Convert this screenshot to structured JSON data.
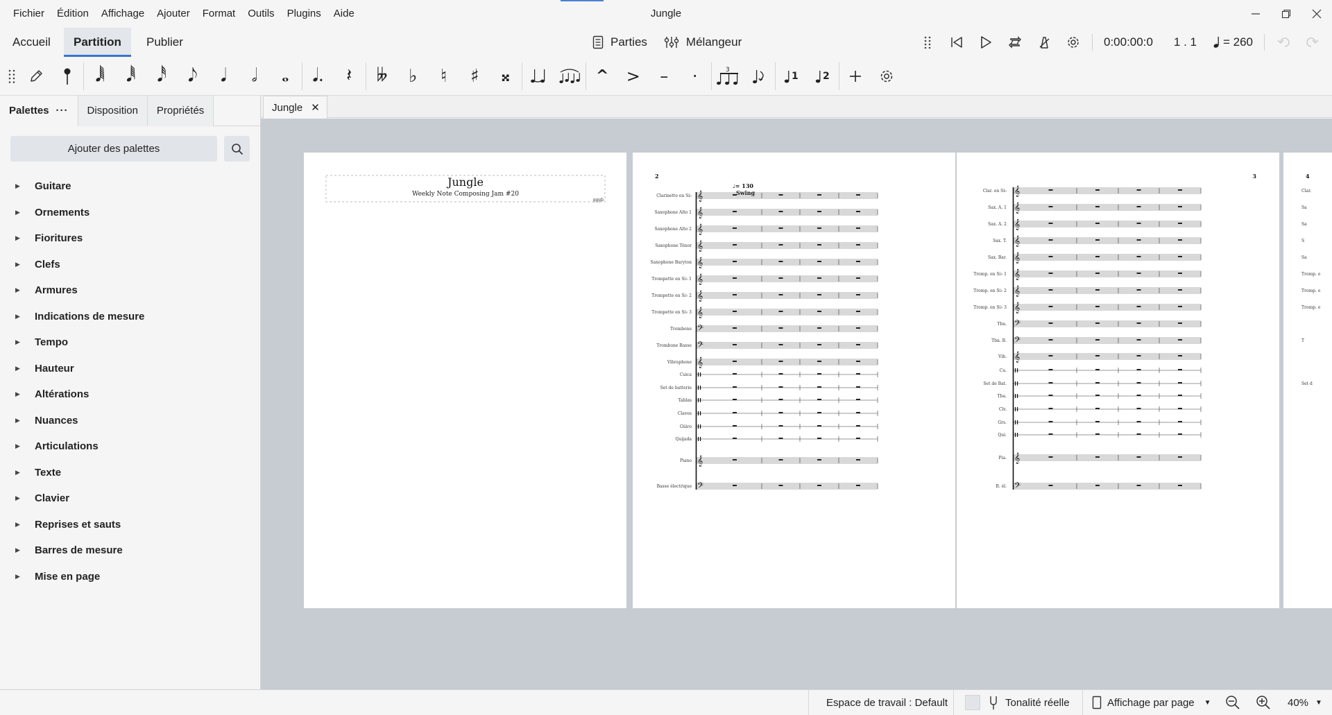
{
  "window": {
    "title": "Jungle"
  },
  "menu": [
    "Fichier",
    "Édition",
    "Affichage",
    "Ajouter",
    "Format",
    "Outils",
    "Plugins",
    "Aide"
  ],
  "workspace_tabs": [
    "Accueil",
    "Partition",
    "Publier"
  ],
  "toolbar": {
    "parts_label": "Parties",
    "mixer_label": "Mélangeur"
  },
  "playback": {
    "time": "0:00:00:0",
    "position": "1 . 1",
    "tempo": "= 260"
  },
  "panel": {
    "tabs": [
      "Palettes",
      "Disposition",
      "Propriétés"
    ],
    "add_button": "Ajouter des palettes",
    "palettes": [
      "Guitare",
      "Ornements",
      "Fioritures",
      "Clefs",
      "Armures",
      "Indications de mesure",
      "Tempo",
      "Hauteur",
      "Altérations",
      "Nuances",
      "Articulations",
      "Texte",
      "Clavier",
      "Reprises et sauts",
      "Barres de mesure",
      "Mise en page"
    ]
  },
  "score_tab": "Jungle",
  "score": {
    "title": "Jungle",
    "subtitle": "Weekly Note Composing Jam #20",
    "composer": "gggb",
    "page2_number": "2",
    "page3_number": "3",
    "page4_number": "4",
    "tempo_mark": "= 130",
    "style_mark": "Swing",
    "page2_staves": [
      "Clarinette en Si♭",
      "Saxophone Alto 1",
      "Saxophone Alto 2",
      "Saxophone Ténor",
      "Saxophone Baryton",
      "Trompette en Si♭ 1",
      "Trompette en Si♭ 2",
      "Trompette en Si♭ 3",
      "Trombone",
      "Trombone Basse",
      "Vibraphone",
      "Cuica",
      "Set de batterie",
      "Tablas",
      "Claves",
      "Güiro",
      "Quijada",
      "Piano",
      "Basse électrique"
    ],
    "page3_staves": [
      "Clar. en Si♭",
      "Sax. A. 1",
      "Sax. A. 2",
      "Sax. T.",
      "Sax. Bar.",
      "Tromp. en Si♭ 1",
      "Tromp. en Si♭ 2",
      "Tromp. en Si♭ 3",
      "Tbn.",
      "Tbn. B.",
      "Vib.",
      "Cu.",
      "Set de Bat.",
      "Tba.",
      "Clv.",
      "Grs.",
      "Qui.",
      "Pia.",
      "B. él."
    ],
    "page4_staves": [
      "Clar.",
      "Sa",
      "Sa",
      "S",
      "Sa",
      "Tromp. e",
      "Tromp. e",
      "Tromp. e",
      "T",
      "Set d"
    ]
  },
  "status": {
    "workspace": "Espace de travail : Default",
    "concert_pitch": "Tonalité réelle",
    "view_mode": "Affichage par page",
    "zoom": "40%"
  }
}
